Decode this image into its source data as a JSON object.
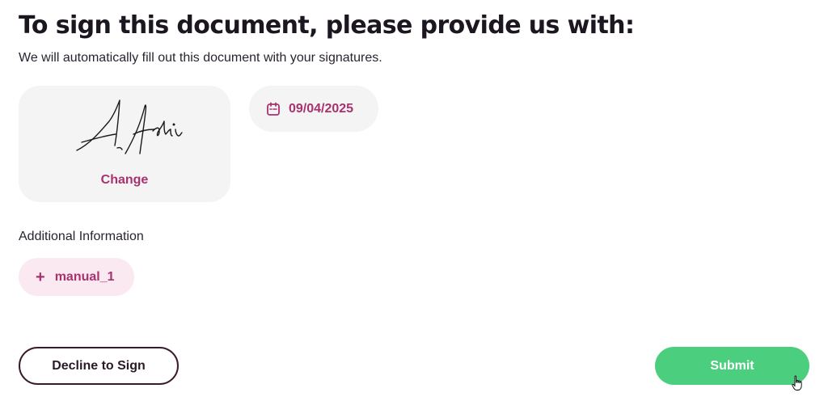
{
  "header": {
    "title": "To sign this document, please provide us with:",
    "subtitle": "We will automatically fill out this document with your signatures."
  },
  "signature": {
    "change_label": "Change",
    "image_icon": "handwritten-signature"
  },
  "date": {
    "value": "09/04/2025",
    "icon": "calendar-icon"
  },
  "additional": {
    "label": "Additional Information",
    "items": [
      {
        "label": "manual_1",
        "icon": "plus-icon"
      }
    ]
  },
  "actions": {
    "decline_label": "Decline to Sign",
    "submit_label": "Submit"
  },
  "colors": {
    "accent": "#a8326e",
    "submit": "#4bcf7e",
    "chip_bg": "#f4f4f4",
    "manual_bg": "#fbe9f2"
  }
}
